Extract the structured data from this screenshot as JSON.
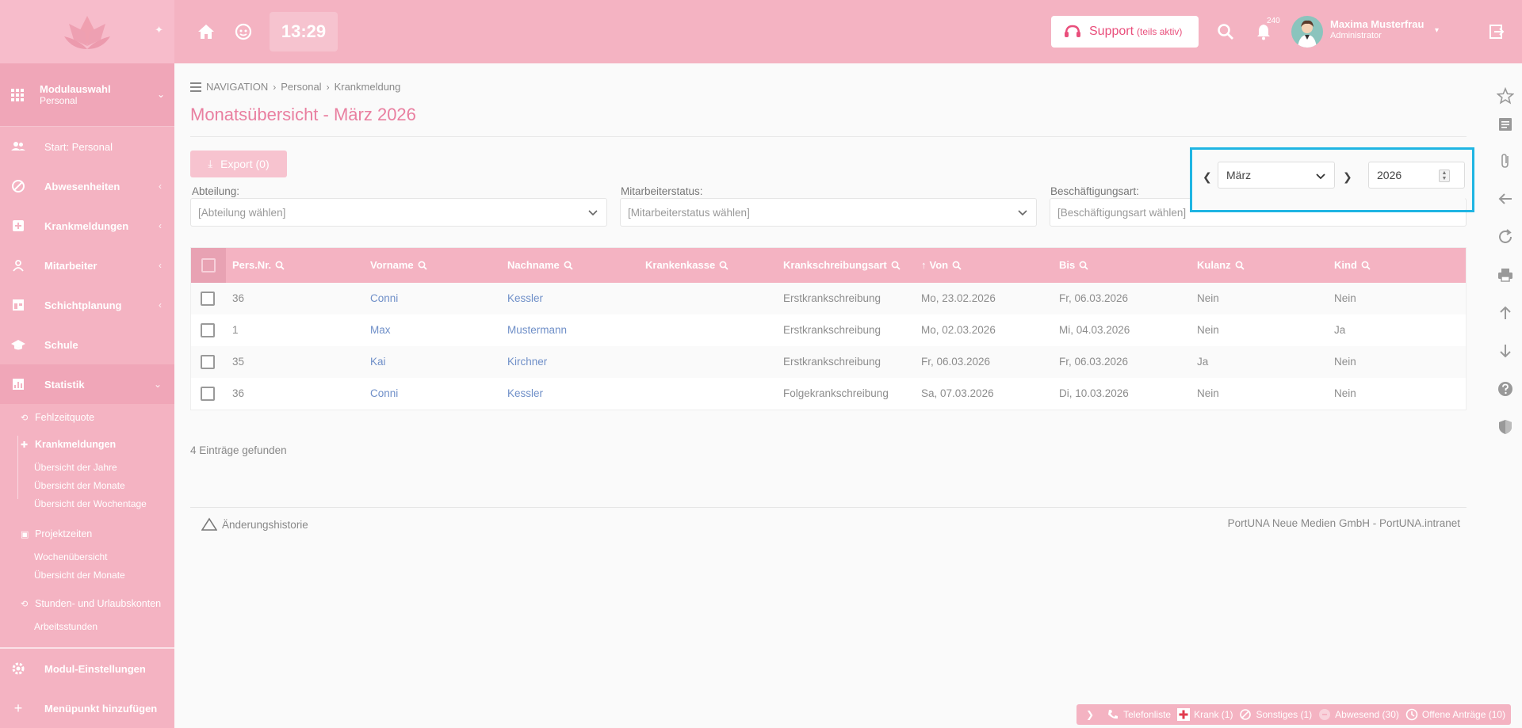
{
  "sidebar": {
    "module": {
      "title": "Modulauswahl",
      "subtitle": "Personal"
    },
    "items": [
      {
        "label": "Start: Personal"
      },
      {
        "label": "Abwesenheiten"
      },
      {
        "label": "Krankmeldungen"
      },
      {
        "label": "Mitarbeiter"
      },
      {
        "label": "Schichtplanung"
      },
      {
        "label": "Schule"
      },
      {
        "label": "Statistik"
      }
    ],
    "statistik": {
      "fehlzeitquote": "Fehlzeitquote",
      "krankmeldungen": "Krankmeldungen",
      "km_leaves": [
        "Übersicht der Jahre",
        "Übersicht der Monate",
        "Übersicht der Wochentage"
      ],
      "projektzeiten": "Projektzeiten",
      "pz_leaves": [
        "Wochenübersicht",
        "Übersicht der Monate"
      ],
      "stunden": "Stunden- und Urlaubskonten",
      "arbeitsstunden": "Arbeitsstunden"
    },
    "bottom": [
      {
        "label": "Modul-Einstellungen"
      },
      {
        "label": "Menüpunkt hinzufügen"
      }
    ]
  },
  "topbar": {
    "clock": "13:29",
    "support": {
      "label": "Support",
      "status": "(teils aktiv)"
    },
    "notifications": "240",
    "user": {
      "name": "Maxima Musterfrau",
      "role": "Administrator"
    }
  },
  "breadcrumb": {
    "nav": "NAVIGATION",
    "level1": "Personal",
    "level2": "Krankmeldung"
  },
  "page": {
    "title": "Monatsübersicht - März 2026",
    "export": "Export (0)"
  },
  "filters": [
    {
      "label": "Abteilung:",
      "placeholder": "[Abteilung wählen]"
    },
    {
      "label": "Mitarbeiterstatus:",
      "placeholder": "[Mitarbeiterstatus wählen]"
    },
    {
      "label": "Beschäftigungsart:",
      "placeholder": "[Beschäftigungsart wählen]"
    }
  ],
  "month_picker": {
    "month": "März",
    "year": "2026"
  },
  "table": {
    "columns": [
      "Pers.Nr.",
      "Vorname",
      "Nachname",
      "Krankenkasse",
      "Krankschreibungsart",
      "Von",
      "Bis",
      "Kulanz",
      "Kind"
    ],
    "rows": [
      [
        "36",
        "Conni",
        "Kessler",
        "",
        "Erstkrankschreibung",
        "Mo, 23.02.2026",
        "Fr, 06.03.2026",
        "Nein",
        "Nein"
      ],
      [
        "1",
        "Max",
        "Mustermann",
        "",
        "Erstkrankschreibung",
        "Mo, 02.03.2026",
        "Mi, 04.03.2026",
        "Nein",
        "Ja"
      ],
      [
        "35",
        "Kai",
        "Kirchner",
        "",
        "Erstkrankschreibung",
        "Fr, 06.03.2026",
        "Fr, 06.03.2026",
        "Ja",
        "Nein"
      ],
      [
        "36",
        "Conni",
        "Kessler",
        "",
        "Folgekrankschreibung",
        "Sa, 07.03.2026",
        "Di, 10.03.2026",
        "Nein",
        "Nein"
      ]
    ]
  },
  "footer": {
    "found": "4 Einträge gefunden",
    "history": "Änderungshistorie",
    "copyright": "PortUNA Neue Medien GmbH - PortUNA.intranet"
  },
  "statusbar": {
    "telefonliste": "Telefonliste",
    "krank": "Krank (1)",
    "sonstiges": "Sonstiges (1)",
    "abwesend": "Abwesend (30)",
    "antraege": "Offene Anträge (10)"
  },
  "colors": {
    "brand": "#f4b3c2",
    "title": "#e97fa0",
    "link": "#6f8fc8",
    "highlight": "#1fb5e3"
  }
}
